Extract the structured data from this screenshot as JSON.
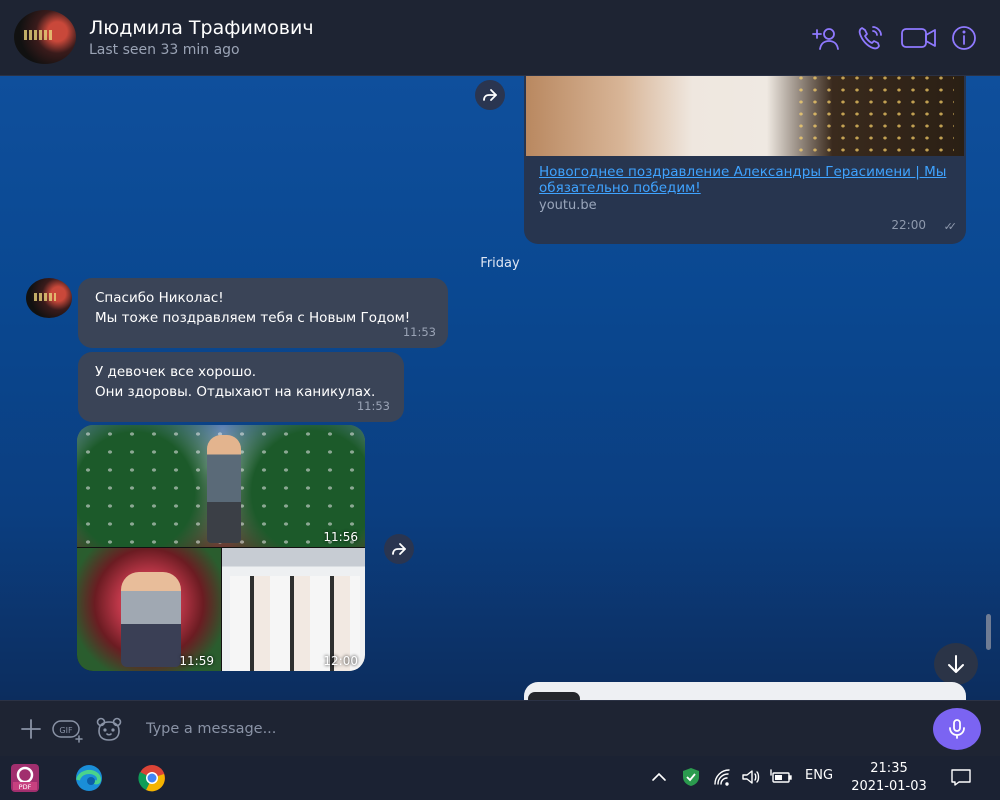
{
  "header": {
    "contact_name": "Людмила Трафимович",
    "status": "Last seen 33 min ago",
    "icons": [
      "add-contact-icon",
      "voice-call-icon",
      "video-call-icon",
      "info-icon"
    ],
    "accent_color": "#8f79ff"
  },
  "link_preview": {
    "title": "Новогоднее поздравление Александры Герасимени | Мы обязательно победим!",
    "domain": "youtu.be",
    "time": "22:00"
  },
  "day_separator": "Friday",
  "messages": [
    {
      "lines": [
        "Спасибо Николас!",
        "Мы тоже поздравляем тебя с Новым Годом!"
      ],
      "time": "11:53"
    },
    {
      "lines": [
        "У девочек все хорошо.",
        "Они здоровы. Отдыхают на каникулах."
      ],
      "time": "11:53"
    }
  ],
  "photos": [
    {
      "time": "11:56"
    },
    {
      "time": "11:59"
    },
    {
      "time": "12:00"
    }
  ],
  "input": {
    "placeholder": "Type a message...",
    "value": "",
    "gif_label": "GIF"
  },
  "taskbar": {
    "apps": [
      "pdf-app-icon",
      "edge-browser-icon",
      "chrome-browser-icon"
    ],
    "pdf_label": "PDF",
    "language": "ENG",
    "time": "21:35",
    "date": "2021-01-03"
  }
}
